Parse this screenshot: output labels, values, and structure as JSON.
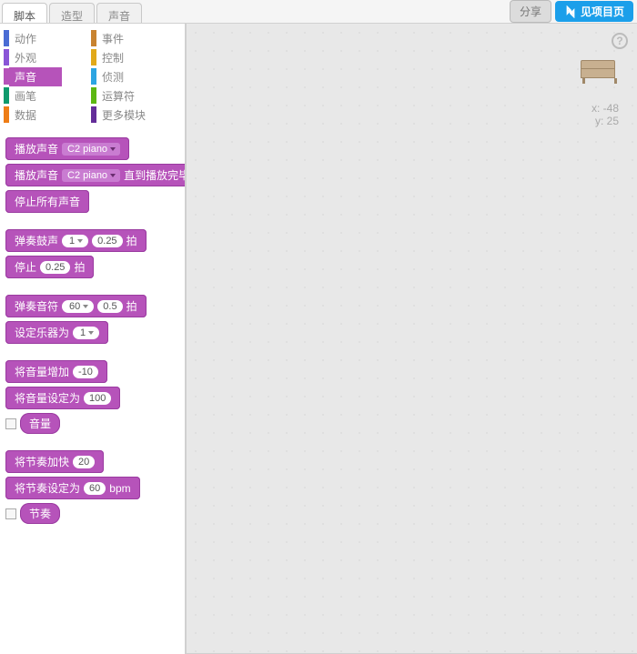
{
  "topbar": {
    "tabs": [
      {
        "label": "脚本",
        "active": true
      },
      {
        "label": "造型",
        "active": false
      },
      {
        "label": "声音",
        "active": false
      }
    ],
    "share": "分享",
    "project": "见项目页"
  },
  "categories": [
    {
      "label": "动作",
      "color": "#4a6cd4"
    },
    {
      "label": "事件",
      "color": "#c88330"
    },
    {
      "label": "外观",
      "color": "#8a55d7"
    },
    {
      "label": "控制",
      "color": "#e1a91a"
    },
    {
      "label": "声音",
      "color": "#b653ba",
      "active": true
    },
    {
      "label": "侦测",
      "color": "#2ca5e2"
    },
    {
      "label": "画笔",
      "color": "#0e9a6c"
    },
    {
      "label": "运算符",
      "color": "#5cb712"
    },
    {
      "label": "数据",
      "color": "#ee7d16"
    },
    {
      "label": "更多模块",
      "color": "#632d99"
    }
  ],
  "blocks": {
    "play_sound": {
      "label": "播放声音",
      "sound": "C2 piano"
    },
    "play_until": {
      "label1": "播放声音",
      "sound": "C2 piano",
      "label2": "直到播放完毕"
    },
    "stop_all": {
      "label": "停止所有声音"
    },
    "drum": {
      "label1": "弹奏鼓声",
      "drum": "1",
      "dur": "0.25",
      "label2": "拍"
    },
    "rest": {
      "label1": "停止",
      "dur": "0.25",
      "label2": "拍"
    },
    "note": {
      "label1": "弹奏音符",
      "note": "60",
      "dur": "0.5",
      "label2": "拍"
    },
    "instrument": {
      "label": "设定乐器为",
      "inst": "1"
    },
    "vol_change": {
      "label": "将音量增加",
      "val": "-10"
    },
    "vol_set": {
      "label": "将音量设定为",
      "val": "100"
    },
    "vol_reporter": {
      "label": "音量"
    },
    "tempo_change": {
      "label": "将节奏加快",
      "val": "20"
    },
    "tempo_set": {
      "label1": "将节奏设定为",
      "val": "60",
      "label2": "bpm"
    },
    "tempo_reporter": {
      "label": "节奏"
    }
  },
  "canvas": {
    "coords": {
      "x_label": "x:",
      "x": "-48",
      "y_label": "y:",
      "y": "25"
    },
    "help": "?"
  }
}
